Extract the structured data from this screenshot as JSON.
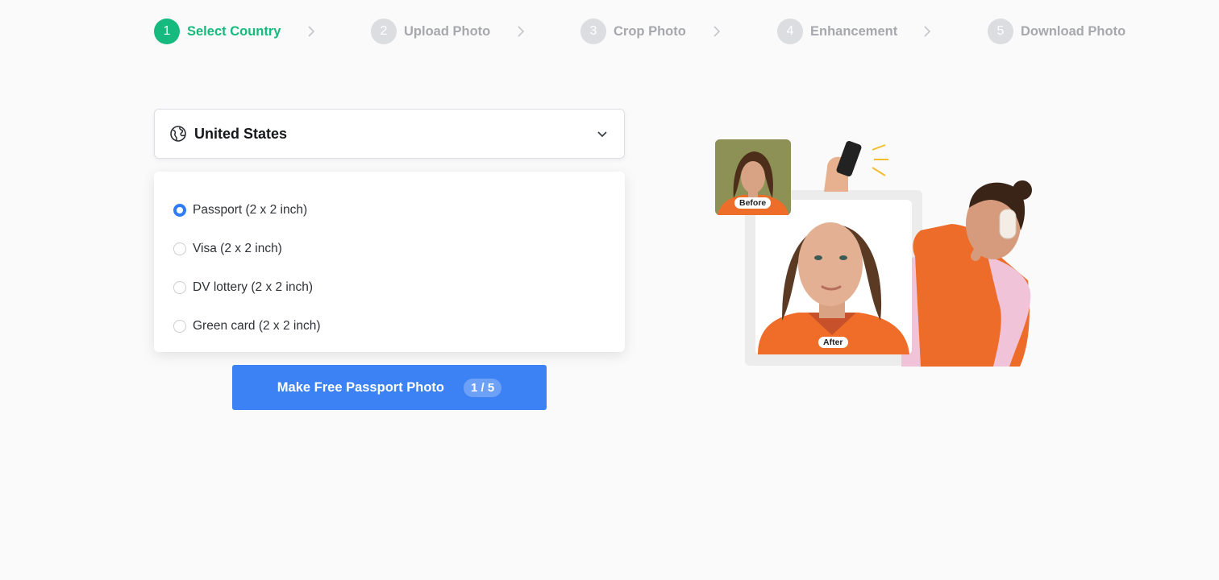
{
  "steps": [
    {
      "num": "1",
      "label": "Select Country",
      "active": true
    },
    {
      "num": "2",
      "label": "Upload Photo",
      "active": false
    },
    {
      "num": "3",
      "label": "Crop Photo",
      "active": false
    },
    {
      "num": "4",
      "label": "Enhancement",
      "active": false
    },
    {
      "num": "5",
      "label": "Download Photo",
      "active": false
    }
  ],
  "country": {
    "selected": "United States",
    "icon": "globe-icon"
  },
  "doc_types": [
    {
      "label": "Passport (2 x 2 inch)",
      "checked": true
    },
    {
      "label": "Visa (2 x 2 inch)",
      "checked": false
    },
    {
      "label": "DV lottery (2 x 2 inch)",
      "checked": false
    },
    {
      "label": "Green card (2 x 2 inch)",
      "checked": false
    }
  ],
  "action": {
    "label": "Make Free Passport Photo",
    "counter": "1 / 5"
  },
  "illustration": {
    "before_label": "Before",
    "after_label": "After"
  },
  "colors": {
    "active_step": "#16b97e",
    "inactive_step": "#dcdde1",
    "primary_button": "#3d82f4",
    "radio_checked": "#2f7cf6"
  }
}
